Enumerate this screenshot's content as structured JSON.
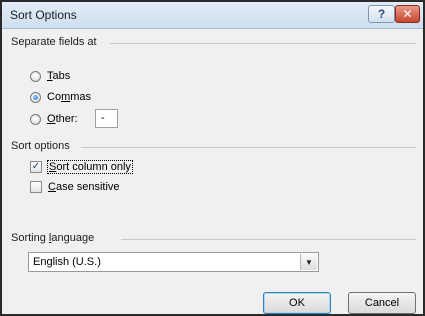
{
  "window": {
    "title": "Sort Options",
    "help_glyph": "?",
    "close_glyph": "✕"
  },
  "separate": {
    "label": "Separate fields at",
    "options": [
      {
        "prefix": "",
        "mnemonic": "T",
        "rest": "abs",
        "selected": false
      },
      {
        "prefix": "Co",
        "mnemonic": "m",
        "rest": "mas",
        "selected": true
      },
      {
        "prefix": "",
        "mnemonic": "O",
        "rest": "ther:",
        "selected": false
      }
    ],
    "other_value": "-"
  },
  "sort_options": {
    "label": "Sort options",
    "column_only": {
      "prefix": "",
      "mnemonic": "S",
      "rest": "ort column only",
      "checked": true
    },
    "case_sensitive": {
      "prefix": "",
      "mnemonic": "C",
      "rest": "ase sensitive",
      "checked": false
    }
  },
  "language": {
    "label_prefix": "Sorting ",
    "label_mnemonic": "l",
    "label_rest": "anguage",
    "selected": "English (U.S.)"
  },
  "buttons": {
    "ok": "OK",
    "cancel": "Cancel"
  }
}
